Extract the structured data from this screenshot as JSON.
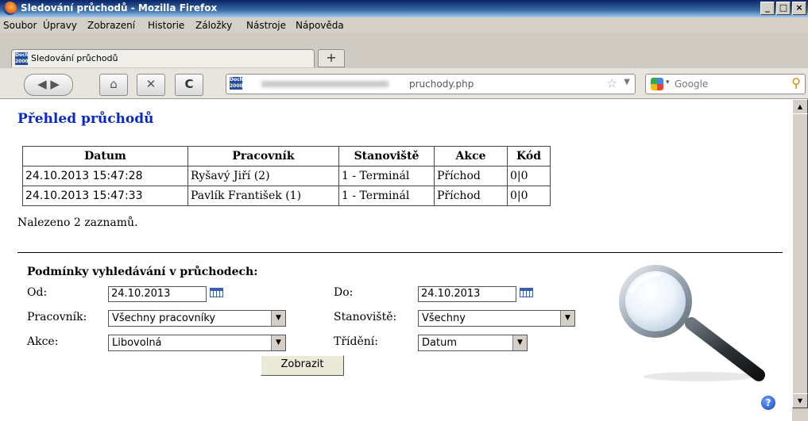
{
  "window": {
    "title": "Sledování průchodů - Mozilla Firefox"
  },
  "menu": {
    "items": [
      "Soubor",
      "Úpravy",
      "Zobrazení",
      "Historie",
      "Záložky",
      "Nástroje",
      "Nápověda"
    ]
  },
  "tabs": [
    {
      "label": "Sledování průchodů"
    }
  ],
  "newtab_label": "+",
  "address": {
    "url_suffix": "pruchody.php"
  },
  "search": {
    "placeholder": "Google"
  },
  "page": {
    "heading": "Přehled průchodů",
    "table": {
      "headers": [
        "Datum",
        "Pracovník",
        "Stanoviště",
        "Akce",
        "Kód"
      ],
      "rows": [
        [
          "24.10.2013 15:47:28",
          "Ryšavý Jiří (2)",
          "1 - Terminál",
          "Příchod",
          "0|0"
        ],
        [
          "24.10.2013 15:47:33",
          "Pavlík František (1)",
          "1 - Terminál",
          "Příchod",
          "0|0"
        ]
      ]
    },
    "found_text": "Nalezeno 2 zaznamů.",
    "filter": {
      "title": "Podmínky vyhledávání v průchodech:",
      "od_label": "Od:",
      "od_value": "24.10.2013",
      "do_label": "Do:",
      "do_value": "24.10.2013",
      "pracovnik_label": "Pracovník:",
      "pracovnik_value": "Všechny pracovníky",
      "stanoviste_label": "Stanoviště:",
      "stanoviste_value": "Všechny",
      "akce_label": "Akce:",
      "akce_value": "Libovolná",
      "trideni_label": "Třídění:",
      "trideni_value": "Datum",
      "submit_label": "Zobrazit"
    },
    "help_label": "?"
  },
  "colors": {
    "heading": "#0a28c8",
    "titlebar": "#0a246a"
  }
}
